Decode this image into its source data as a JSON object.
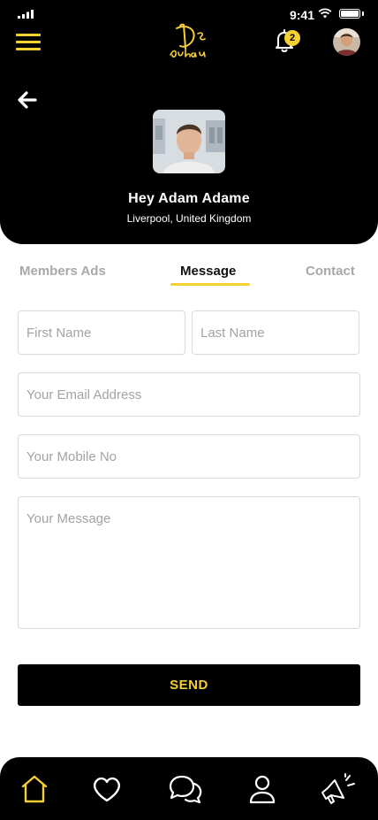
{
  "status_bar": {
    "time": "9:41"
  },
  "header": {
    "notification_count": "2",
    "profile": {
      "name": "Hey Adam Adame",
      "location": "Liverpool, United Kingdom"
    }
  },
  "tabs": [
    {
      "label": "Members Ads",
      "active": false
    },
    {
      "label": "Message",
      "active": true
    },
    {
      "label": "Contact",
      "active": false
    }
  ],
  "form": {
    "first_name": {
      "value": "",
      "placeholder": "First Name"
    },
    "last_name": {
      "value": "",
      "placeholder": "Last Name"
    },
    "email": {
      "value": "",
      "placeholder": "Your Email Address"
    },
    "mobile": {
      "value": "",
      "placeholder": "Your Mobile No"
    },
    "message": {
      "value": "",
      "placeholder": "Your Message"
    },
    "send_label": "SEND"
  },
  "bottom_nav": {
    "items": [
      "home-icon",
      "heart-icon",
      "chat-icon",
      "user-icon",
      "megaphone-icon"
    ],
    "active": "home-icon"
  },
  "colors": {
    "accent": "#f5d033",
    "header_bg": "#000000",
    "tab_inactive": "#a8a8a8",
    "border": "#d9d9d9"
  }
}
